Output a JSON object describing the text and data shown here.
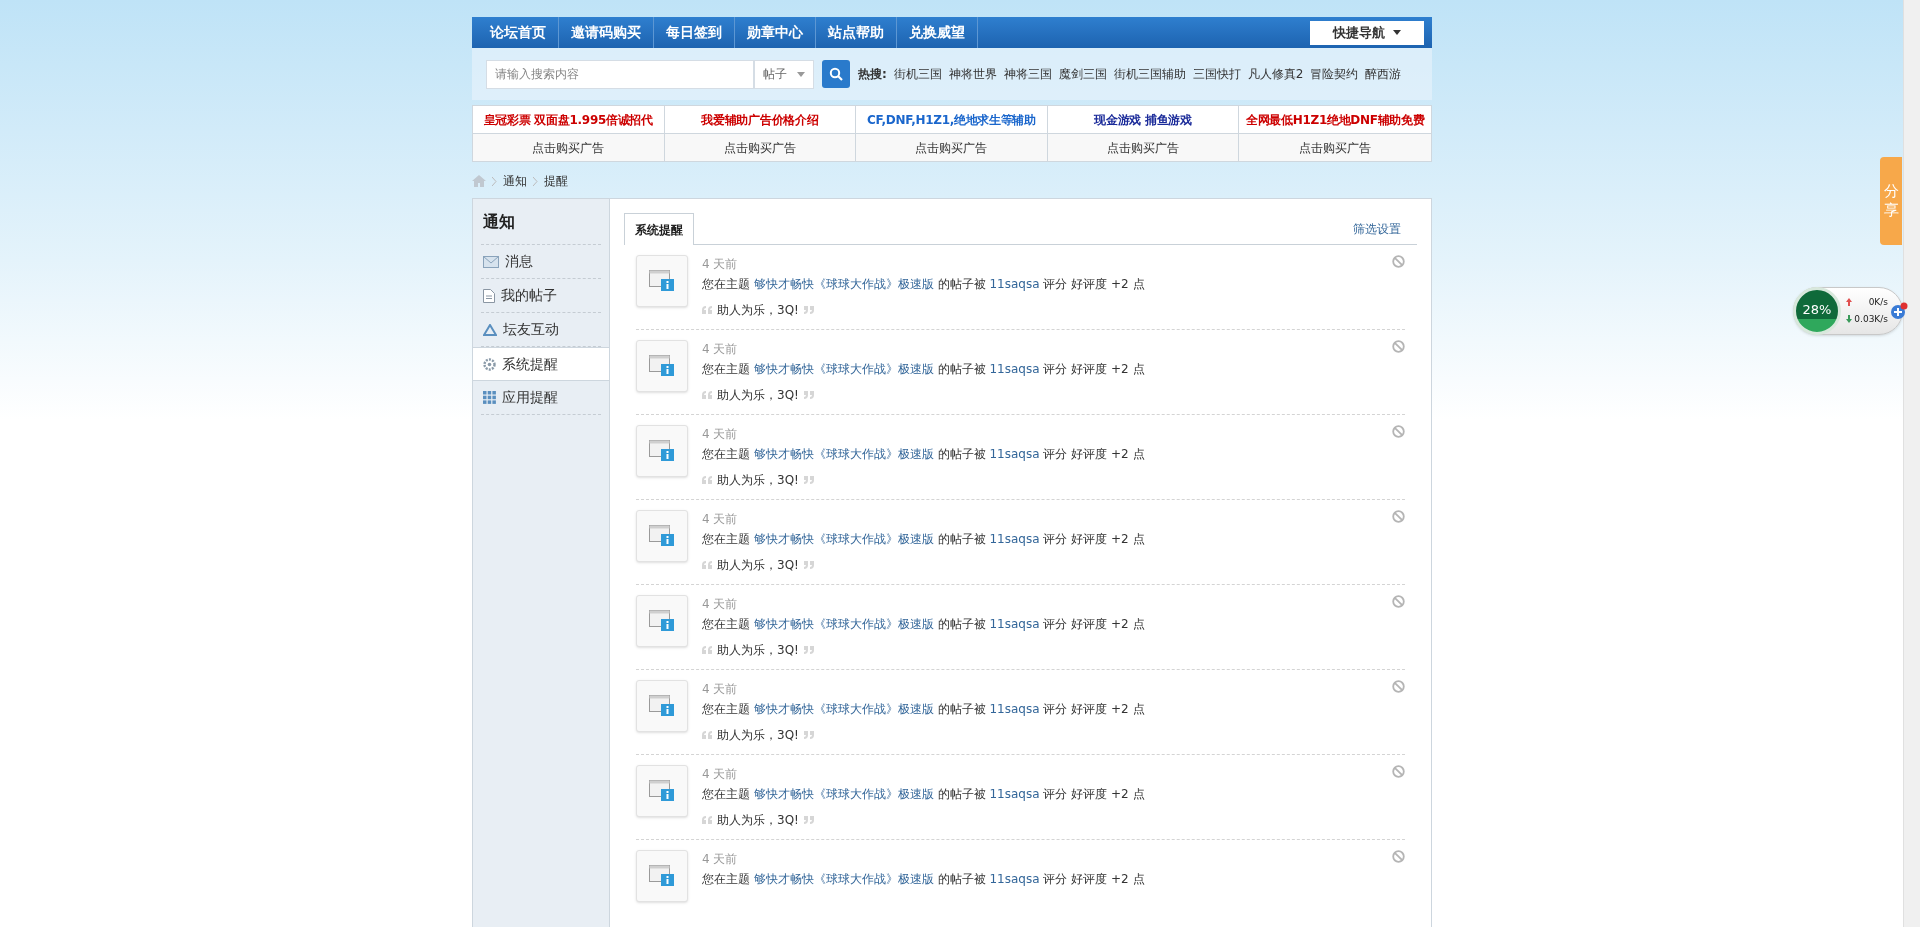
{
  "nav": {
    "items": [
      {
        "label": "论坛首页"
      },
      {
        "label": "邀请码购买"
      },
      {
        "label": "每日签到"
      },
      {
        "label": "勋章中心"
      },
      {
        "label": "站点帮助"
      },
      {
        "label": "兑换威望"
      }
    ],
    "quick_nav": "快捷导航"
  },
  "search": {
    "placeholder": "请输入搜索内容",
    "scope": "帖子",
    "hot_label": "热搜:",
    "hot": [
      "街机三国",
      "神将世界",
      "神将三国",
      "魔剑三国",
      "街机三国辅助",
      "三国快打",
      "凡人修真2",
      "冒险契约",
      "醉西游"
    ]
  },
  "ads": [
    {
      "title": "皇冠彩票 双面盘1.995倍诚招代",
      "color": "#cc0000",
      "link": "点击购买广告"
    },
    {
      "title": "我爱辅助广告价格介绍",
      "color": "#cc0000",
      "link": "点击购买广告"
    },
    {
      "title": "CF,DNF,H1Z1,绝地求生等辅助",
      "color": "#1a66cc",
      "link": "点击购买广告"
    },
    {
      "title": "现金游戏 捕鱼游戏",
      "color": "#1a2a99",
      "link": "点击购买广告"
    },
    {
      "title": "全网最低H1Z1绝地DNF辅助免费",
      "color": "#cc0000",
      "link": "点击购买广告"
    }
  ],
  "breadcrumb": [
    "通知",
    "提醒"
  ],
  "sidebar": {
    "title": "通知",
    "items": [
      {
        "label": "消息",
        "kind": "mail",
        "selected": false
      },
      {
        "label": "我的帖子",
        "kind": "doc",
        "selected": false
      },
      {
        "label": "坛友互动",
        "kind": "recycle",
        "selected": false
      },
      {
        "label": "系统提醒",
        "kind": "gear",
        "selected": true
      },
      {
        "label": "应用提醒",
        "kind": "grid",
        "selected": false
      }
    ]
  },
  "tabs": [
    {
      "label": "系统提醒",
      "selected": true
    }
  ],
  "filter_link": "筛选设置",
  "notifications": [
    {
      "time": "4 天前",
      "text": "您在主题 ",
      "topic": "够快才畅快《球球大作战》极速版",
      "middle": " 的帖子被 ",
      "user": "11saqsa",
      "suffix": " 评分 好评度 +2 点",
      "quote": "助人为乐，3Q!"
    },
    {
      "time": "4 天前",
      "text": "您在主题 ",
      "topic": "够快才畅快《球球大作战》极速版",
      "middle": " 的帖子被 ",
      "user": "11saqsa",
      "suffix": " 评分 好评度 +2 点",
      "quote": "助人为乐，3Q!"
    },
    {
      "time": "4 天前",
      "text": "您在主题 ",
      "topic": "够快才畅快《球球大作战》极速版",
      "middle": " 的帖子被 ",
      "user": "11saqsa",
      "suffix": " 评分 好评度 +2 点",
      "quote": "助人为乐，3Q!"
    },
    {
      "time": "4 天前",
      "text": "您在主题 ",
      "topic": "够快才畅快《球球大作战》极速版",
      "middle": " 的帖子被 ",
      "user": "11saqsa",
      "suffix": " 评分 好评度 +2 点",
      "quote": "助人为乐，3Q!"
    },
    {
      "time": "4 天前",
      "text": "您在主题 ",
      "topic": "够快才畅快《球球大作战》极速版",
      "middle": " 的帖子被 ",
      "user": "11saqsa",
      "suffix": " 评分 好评度 +2 点",
      "quote": "助人为乐，3Q!"
    },
    {
      "time": "4 天前",
      "text": "您在主题 ",
      "topic": "够快才畅快《球球大作战》极速版",
      "middle": " 的帖子被 ",
      "user": "11saqsa",
      "suffix": " 评分 好评度 +2 点",
      "quote": "助人为乐，3Q!"
    },
    {
      "time": "4 天前",
      "text": "您在主题 ",
      "topic": "够快才畅快《球球大作战》极速版",
      "middle": " 的帖子被 ",
      "user": "11saqsa",
      "suffix": " 评分 好评度 +2 点",
      "quote": "助人为乐，3Q!"
    },
    {
      "time": "4 天前",
      "text": "您在主题 ",
      "topic": "够快才畅快《球球大作战》极速版",
      "middle": " 的帖子被 ",
      "user": "11saqsa",
      "suffix": " 评分 好评度 +2 点"
    }
  ],
  "share_tab": "分享",
  "speed_widget": {
    "percent": "28%",
    "up": "0K/s",
    "down": "0.03K/s"
  }
}
